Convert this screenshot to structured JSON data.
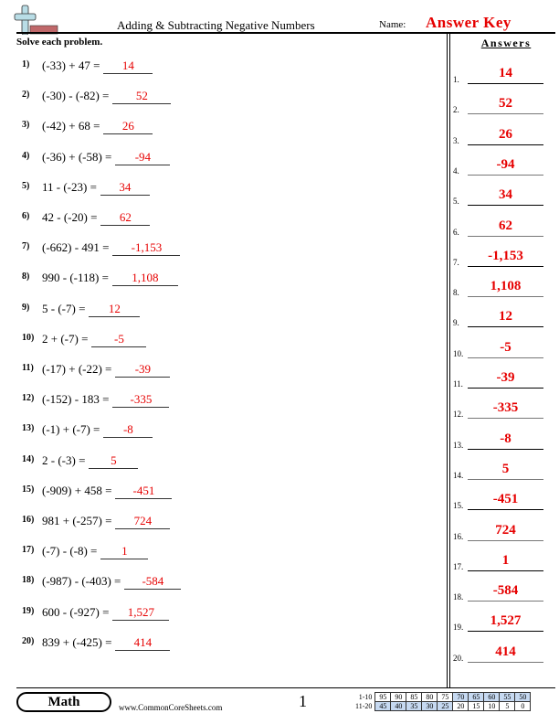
{
  "header": {
    "title": "Adding & Subtracting Negative Numbers",
    "name_label": "Name:",
    "name_value": "Answer Key",
    "logo_icon": "plus-minus-logo-icon"
  },
  "instructions": "Solve each problem.",
  "problems": [
    {
      "num": "1)",
      "expr": "(-33) + 47 =",
      "answer": "14"
    },
    {
      "num": "2)",
      "expr": "(-30) - (-82) =",
      "answer": "52"
    },
    {
      "num": "3)",
      "expr": "(-42) + 68 =",
      "answer": "26"
    },
    {
      "num": "4)",
      "expr": "(-36) + (-58) =",
      "answer": "-94"
    },
    {
      "num": "5)",
      "expr": "11 - (-23) =",
      "answer": "34"
    },
    {
      "num": "6)",
      "expr": "42 - (-20) =",
      "answer": "62"
    },
    {
      "num": "7)",
      "expr": "(-662) - 491 =",
      "answer": "-1,153"
    },
    {
      "num": "8)",
      "expr": "990 - (-118) =",
      "answer": "1,108"
    },
    {
      "num": "9)",
      "expr": "5 - (-7) =",
      "answer": "12"
    },
    {
      "num": "10)",
      "expr": "2 + (-7) =",
      "answer": "-5"
    },
    {
      "num": "11)",
      "expr": "(-17) + (-22) =",
      "answer": "-39"
    },
    {
      "num": "12)",
      "expr": "(-152) - 183 =",
      "answer": "-335"
    },
    {
      "num": "13)",
      "expr": "(-1) + (-7) =",
      "answer": "-8"
    },
    {
      "num": "14)",
      "expr": "2 - (-3) =",
      "answer": "5"
    },
    {
      "num": "15)",
      "expr": "(-909) + 458 =",
      "answer": "-451"
    },
    {
      "num": "16)",
      "expr": "981 + (-257) =",
      "answer": "724"
    },
    {
      "num": "17)",
      "expr": "(-7) - (-8) =",
      "answer": "1"
    },
    {
      "num": "18)",
      "expr": "(-987) - (-403) =",
      "answer": "-584"
    },
    {
      "num": "19)",
      "expr": "600 - (-927) =",
      "answer": "1,527"
    },
    {
      "num": "20)",
      "expr": "839 + (-425) =",
      "answer": "414"
    }
  ],
  "answers_panel": {
    "title": "Answers",
    "items": [
      {
        "num": "1.",
        "value": "14"
      },
      {
        "num": "2.",
        "value": "52"
      },
      {
        "num": "3.",
        "value": "26"
      },
      {
        "num": "4.",
        "value": "-94"
      },
      {
        "num": "5.",
        "value": "34"
      },
      {
        "num": "6.",
        "value": "62"
      },
      {
        "num": "7.",
        "value": "-1,153"
      },
      {
        "num": "8.",
        "value": "1,108"
      },
      {
        "num": "9.",
        "value": "12"
      },
      {
        "num": "10.",
        "value": "-5"
      },
      {
        "num": "11.",
        "value": "-39"
      },
      {
        "num": "12.",
        "value": "-335"
      },
      {
        "num": "13.",
        "value": "-8"
      },
      {
        "num": "14.",
        "value": "5"
      },
      {
        "num": "15.",
        "value": "-451"
      },
      {
        "num": "16.",
        "value": "724"
      },
      {
        "num": "17.",
        "value": "1"
      },
      {
        "num": "18.",
        "value": "-584"
      },
      {
        "num": "19.",
        "value": "1,527"
      },
      {
        "num": "20.",
        "value": "414"
      }
    ]
  },
  "footer": {
    "subject": "Math",
    "website": "www.CommonCoreSheets.com",
    "page_number": "1",
    "score_table": [
      {
        "label": "1-10",
        "scores": [
          "95",
          "90",
          "85",
          "80",
          "75",
          "70",
          "65",
          "60",
          "55",
          "50"
        ]
      },
      {
        "label": "11-20",
        "scores": [
          "45",
          "40",
          "35",
          "30",
          "25",
          "20",
          "15",
          "10",
          "5",
          "0"
        ]
      }
    ]
  }
}
